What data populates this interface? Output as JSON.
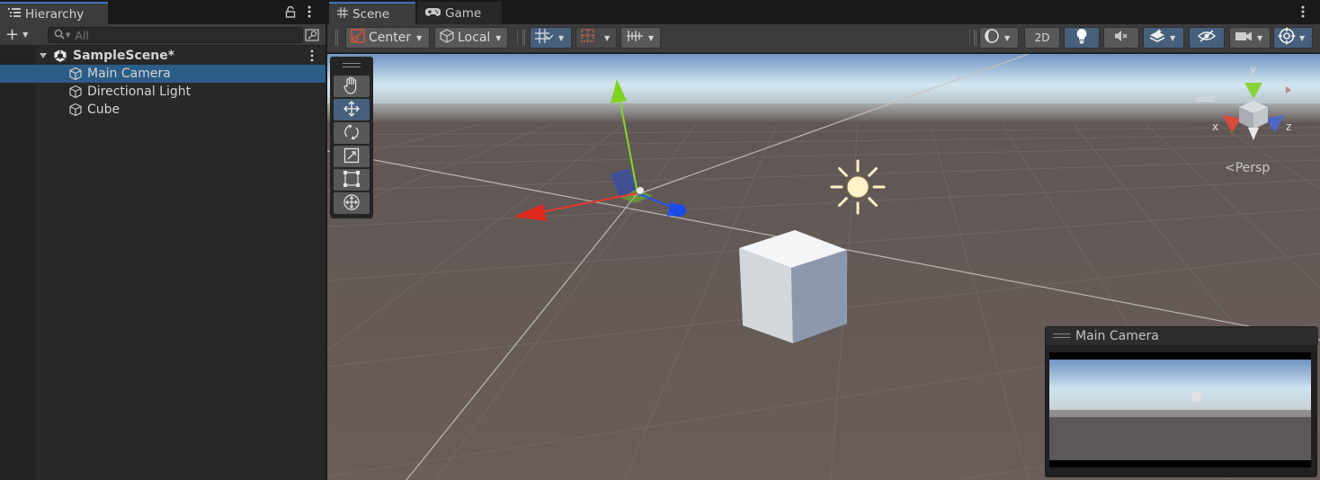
{
  "hierarchy": {
    "tab_label": "Hierarchy",
    "add_label": "+",
    "search_placeholder": "All",
    "scene_name": "SampleScene*",
    "items": [
      {
        "label": "Main Camera",
        "selected": true
      },
      {
        "label": "Directional Light",
        "selected": false
      },
      {
        "label": "Cube",
        "selected": false
      }
    ]
  },
  "scene": {
    "tabs": [
      {
        "label": "Scene",
        "icon": "grid-icon",
        "active": true
      },
      {
        "label": "Game",
        "icon": "gamepad-icon",
        "active": false
      }
    ],
    "toolbar": {
      "pivot_label": "Center",
      "space_label": "Local",
      "mode_2d_label": "2D"
    },
    "gizmo": {
      "y_label": "y",
      "x_label": "x",
      "z_label": "z",
      "projection_label": "<Persp"
    },
    "camera_preview_title": "Main Camera"
  },
  "colors": {
    "accent": "#3a79bb",
    "selection": "#2c5d87",
    "active_button": "#46607c",
    "axis_x": "#e33b2e",
    "axis_y": "#86d62c",
    "axis_z": "#1f53f2"
  }
}
